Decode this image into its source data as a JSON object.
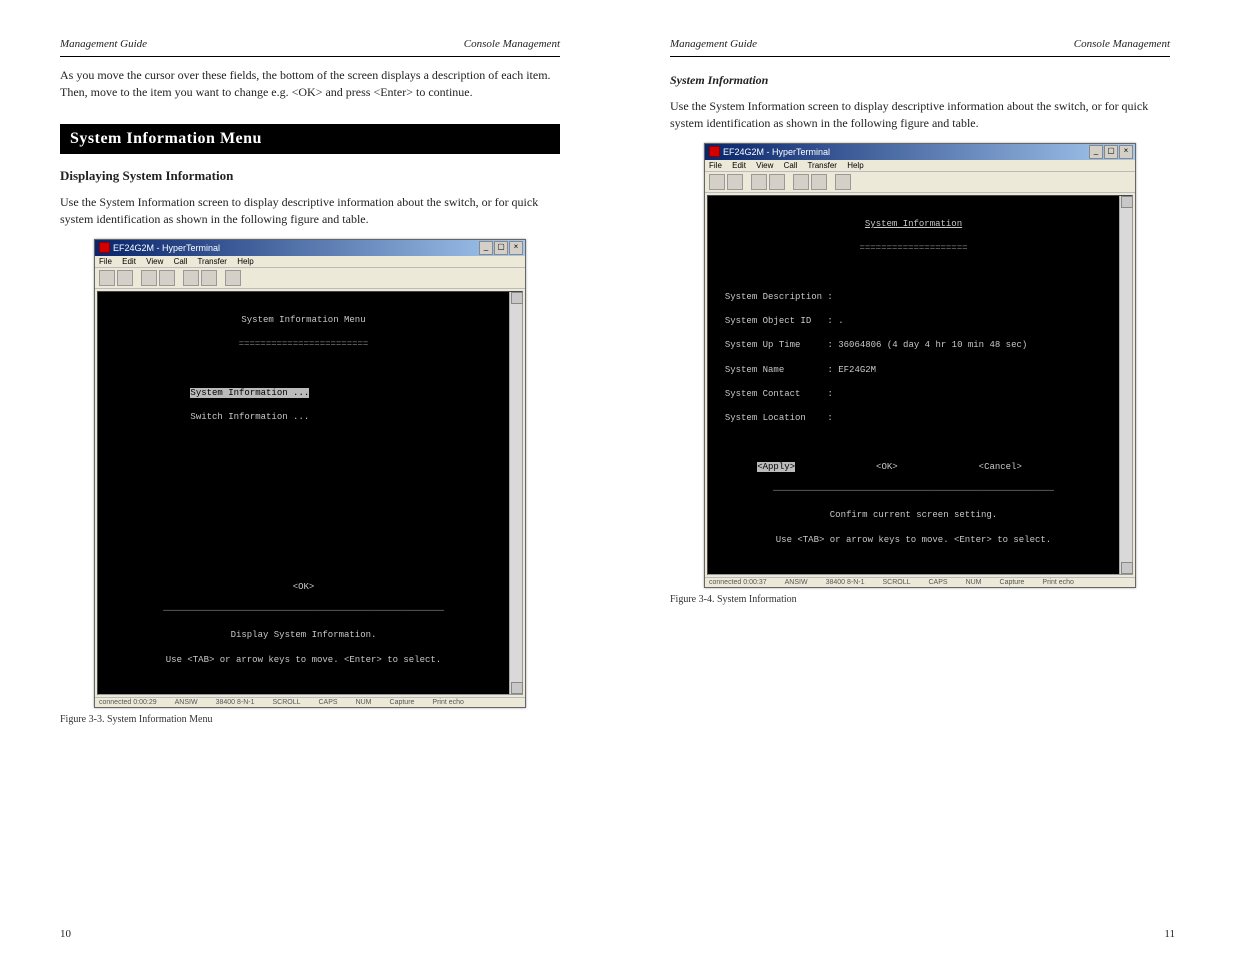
{
  "leftPage": {
    "headerLeft": "Management Guide",
    "headerRight": "Console Management",
    "para1": "As you move the cursor over these fields, the bottom of the screen displays a description of each item.  Then, move to the item you want to change e.g. <OK> and press <Enter> to continue.",
    "sectionTitle": "System Information Menu",
    "subhead": "Displaying System Information",
    "para2": "Use the System Information screen to display descriptive information about the switch, or for quick system identification as shown in the following figure and table.",
    "figcap": "Figure 3-3.  System Information Menu",
    "pagenum": "10",
    "ht": {
      "title": "EF24G2M - HyperTerminal",
      "menu": [
        "File",
        "Edit",
        "View",
        "Call",
        "Transfer",
        "Help"
      ],
      "termTitle": "System Information Menu",
      "item1": "System Information ...",
      "item2": "Switch Information ...",
      "ok": "<OK>",
      "foot1": "Display System Information.",
      "foot2": "Use <TAB> or arrow keys to move. <Enter> to select.",
      "status": [
        "connected 0:00:29",
        "ANSIW",
        "38400 8-N-1",
        "SCROLL",
        "CAPS",
        "NUM",
        "Capture",
        "Print echo"
      ]
    }
  },
  "rightPage": {
    "headerLeft": "Management Guide",
    "headerRight": "Console Management",
    "subheadIt": "System Information",
    "para1": "Use the System Information screen to display descriptive information about the switch, or for quick system identification as shown in the following figure and table.",
    "figcap": "Figure 3-4.  System Information",
    "pagenum": "11",
    "ht": {
      "title": "EF24G2M - HyperTerminal",
      "menu": [
        "File",
        "Edit",
        "View",
        "Call",
        "Transfer",
        "Help"
      ],
      "termTitle": "System Information",
      "rows": [
        {
          "label": "System Description",
          "value": ""
        },
        {
          "label": "System Object ID",
          "value": "."
        },
        {
          "label": "System Up Time",
          "value": "36064806 (4 day 4 hr 10 min 48 sec)"
        },
        {
          "label": "System Name",
          "value": "EF24G2M"
        },
        {
          "label": "System Contact",
          "value": ""
        },
        {
          "label": "System Location",
          "value": ""
        }
      ],
      "btnApply": "<Apply>",
      "btnOk": "<OK>",
      "btnCancel": "<Cancel>",
      "foot1": "Confirm current screen setting.",
      "foot2": "Use <TAB> or arrow keys to move. <Enter> to select.",
      "status": [
        "connected 0:00:37",
        "ANSIW",
        "38400 8-N-1",
        "SCROLL",
        "CAPS",
        "NUM",
        "Capture",
        "Print echo"
      ]
    }
  }
}
